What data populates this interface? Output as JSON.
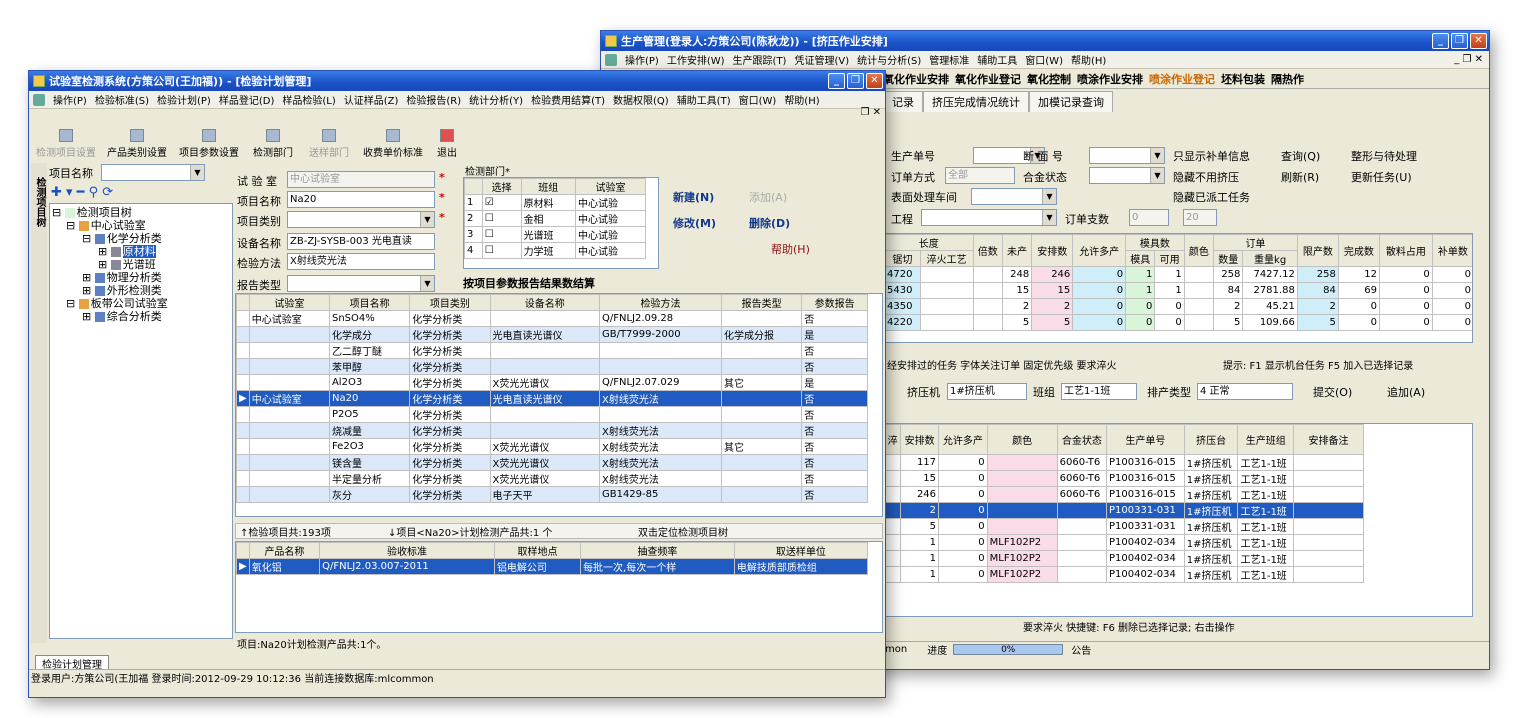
{
  "win2": {
    "title": "生产管理(登录人:方策公司(陈秋龙)) - [挤压作业安排]",
    "menu": [
      "操作(P)",
      "工作安排(W)",
      "生产跟踪(T)",
      "凭证管理(V)",
      "统计与分析(S)",
      "管理标准",
      "辅助工具",
      "窗口(W)",
      "帮助(H)"
    ],
    "subtabs": [
      "氧化作业安排",
      "氧化作业登记",
      "氧化控制",
      "喷涂作业安排",
      "喷涂作业登记",
      "坯料包装",
      "隔热作"
    ],
    "pagetabs": [
      "记录",
      "挤压完成情况统计",
      "加模记录查询"
    ],
    "filters": {
      "prod_no": "生产单号",
      "section_no": "断 面 号",
      "order_type": "订单方式",
      "order_type_val": "全部",
      "alloy": "合金状态",
      "surface": "表面处理车间",
      "process": "工程",
      "order_count": "订单支数",
      "order_count_val": "0",
      "order_count_to": "20",
      "only_replenish": "只显示补单信息",
      "hide_unused": "隐藏不用挤压",
      "hide_dispatched": "隐藏已派工任务",
      "query": "查询(Q)",
      "shape": "整形与待处理",
      "refresh": "刷新(R)",
      "update": "更新任务(U)"
    },
    "upper_headers": [
      "长度",
      "倍数",
      "未产",
      "安排数",
      "允许多产",
      "模具数",
      "颜色",
      "订单",
      "限产数",
      "完成数",
      "散料占用",
      "补单数"
    ],
    "upper_sub": [
      "锯切",
      "淬火工艺",
      "模具",
      "可用",
      "数量",
      "重量kg"
    ],
    "upper_rows": [
      [
        "4720",
        "248",
        "246",
        "0",
        "1",
        "1",
        "258",
        "7427.12",
        "258",
        "12",
        "0",
        "0"
      ],
      [
        "5430",
        "15",
        "15",
        "0",
        "1",
        "1",
        "84",
        "2781.88",
        "84",
        "69",
        "0",
        "0"
      ],
      [
        "4350",
        "2",
        "2",
        "0",
        "0",
        "0",
        "2",
        "45.21",
        "2",
        "0",
        "0",
        "0"
      ],
      [
        "4220",
        "5",
        "5",
        "0",
        "0",
        "0",
        "5",
        "109.66",
        "5",
        "0",
        "0",
        "0"
      ]
    ],
    "legend_upper": "经安排过的任务  字体关注订单  固定优先级  要求淬火",
    "hint_upper": "提示: F1 显示机台任务    F5 加入已选择记录",
    "press": "挤压机",
    "press_val": "1#挤压机",
    "shift": "班组",
    "shift_val": "工艺1-1班",
    "sort": "排产类型",
    "sort_val": "4 正常",
    "submit": "提交(O)",
    "append": "追加(A)",
    "lower_headers": [
      "淬",
      "安排数",
      "允许多产",
      "颜色",
      "合金状态",
      "生产单号",
      "挤压台",
      "生产班组",
      "安排备注"
    ],
    "lower_rows": [
      [
        "117",
        "0",
        "",
        "6060-T6",
        "P100316-015",
        "1#挤压机",
        "工艺1-1班"
      ],
      [
        "15",
        "0",
        "",
        "6060-T6",
        "P100316-015",
        "1#挤压机",
        "工艺1-1班"
      ],
      [
        "246",
        "0",
        "",
        "6060-T6",
        "P100316-015",
        "1#挤压机",
        "工艺1-1班"
      ],
      [
        "2",
        "0",
        "",
        "",
        "P100331-031",
        "1#挤压机",
        "工艺1-1班"
      ],
      [
        "5",
        "0",
        "",
        "",
        "P100331-031",
        "1#挤压机",
        "工艺1-1班"
      ],
      [
        "1",
        "0",
        "MLF102P2",
        "",
        "P100402-034",
        "1#挤压机",
        "工艺1-1班"
      ],
      [
        "1",
        "0",
        "MLF102P2",
        "",
        "P100402-034",
        "1#挤压机",
        "工艺1-1班"
      ],
      [
        "1",
        "0",
        "MLF102P2",
        "",
        "P100402-034",
        "1#挤压机",
        "工艺1-1班"
      ]
    ],
    "legend_lower": "要求淬火      快捷键: F6 删除已选择记录;  右击操作",
    "status_db": "mon",
    "status_progress": "进度",
    "status_pct": "0%",
    "status_notice": "公告"
  },
  "win1": {
    "title": "试验室检测系统(方策公司(王加福)) - [检验计划管理]",
    "menu": [
      "操作(P)",
      "检验标准(S)",
      "检验计划(P)",
      "样品登记(D)",
      "样品检验(L)",
      "认证样品(Z)",
      "检验报告(R)",
      "统计分析(Y)",
      "检验费用结算(T)",
      "数据权限(Q)",
      "辅助工具(T)",
      "窗口(W)",
      "帮助(H)"
    ],
    "toolbar": [
      "检测项目设置",
      "产品类别设置",
      "项目参数设置",
      "检测部门",
      "送样部门",
      "收费单价标准",
      "退出"
    ],
    "tree_label": "项目名称",
    "side_tab": "检测项目树",
    "tree": [
      "检测项目树",
      "中心试验室",
      "化学分析类",
      "原材料",
      "光谱班",
      "物理分析类",
      "外形检测类",
      "板带公司试验室",
      "综合分析类"
    ],
    "form": {
      "lab": "试 验 室",
      "lab_val": "中心试验室",
      "name": "项目名称",
      "name_val": "Na20",
      "cat": "项目类别",
      "equip": "设备名称",
      "equip_val": "ZB-ZJ-SYSB-003 光电直读",
      "method": "检验方法",
      "method_val": "X射线荧光法",
      "rtype": "报告类型",
      "dept": "检测部门*",
      "by_param": "按项目参数报告结果数结算",
      "new": "新建(N)",
      "add": "添加(A)",
      "modify": "修改(M)",
      "delete": "删除(D)",
      "help": "帮助(H)"
    },
    "dept_headers": [
      "选择",
      "班组",
      "试验室"
    ],
    "dept_rows": [
      [
        "1",
        "原材料",
        "中心试验"
      ],
      [
        "2",
        "金相",
        "中心试验"
      ],
      [
        "3",
        "光谱班",
        "中心试验"
      ],
      [
        "4",
        "力学班",
        "中心试验"
      ]
    ],
    "main_headers": [
      "试验室",
      "项目名称",
      "项目类别",
      "设备名称",
      "检验方法",
      "报告类型",
      "参数报告"
    ],
    "main_rows": [
      [
        "中心试验室",
        "SnSO4%",
        "化学分析类",
        "",
        "Q/FNLJ2.09.28",
        "",
        "否"
      ],
      [
        "",
        "化学成分",
        "化学分析类",
        "光电直读光谱仪",
        "GB/T7999-2000",
        "化学成分报",
        "是"
      ],
      [
        "",
        "乙二醇丁醚",
        "化学分析类",
        "",
        "",
        "",
        "否"
      ],
      [
        "",
        "苯甲醇",
        "化学分析类",
        "",
        "",
        "",
        "否"
      ],
      [
        "",
        "Al2O3",
        "化学分析类",
        "X荧光光谱仪",
        "Q/FNLJ2.07.029",
        "其它",
        "是"
      ],
      [
        "中心试验室",
        "Na20",
        "化学分析类",
        "光电直读光谱仪",
        "X射线荧光法",
        "",
        "否"
      ],
      [
        "",
        "P2O5",
        "化学分析类",
        "",
        "",
        "",
        "否"
      ],
      [
        "",
        "烧减量",
        "化学分析类",
        "",
        "X射线荧光法",
        "",
        "否"
      ],
      [
        "",
        "Fe2O3",
        "化学分析类",
        "X荧光光谱仪",
        "X射线荧光法",
        "其它",
        "否"
      ],
      [
        "",
        "镁含量",
        "化学分析类",
        "X荧光光谱仪",
        "X射线荧光法",
        "",
        "否"
      ],
      [
        "",
        "半定量分析",
        "化学分析类",
        "X荧光光谱仪",
        "X射线荧光法",
        "",
        "否"
      ],
      [
        "",
        "灰分",
        "化学分析类",
        "电子天平",
        "GB1429-85",
        "",
        "否"
      ]
    ],
    "count1": "↑检验项目共:193项",
    "count2": "↓项目<Na20>计划检测产品共:1 个",
    "count3": "双击定位检测项目树",
    "prod_headers": [
      "产品名称",
      "验收标准",
      "取样地点",
      "抽查频率",
      "取送样单位"
    ],
    "prod_rows": [
      [
        "氧化铝",
        "Q/FNLJ2.03.007-2011",
        "铝电解公司",
        "每批一次,每次一个样",
        "电解技质部质检组"
      ]
    ],
    "bottom_info": "项目:Na20计划检测产品共:1个。",
    "bottom_tab": "检验计划管理",
    "status": "登录用户:方策公司(王加福 登录时间:2012-09-29 10:12:36 当前连接数据库:mlcommon"
  }
}
